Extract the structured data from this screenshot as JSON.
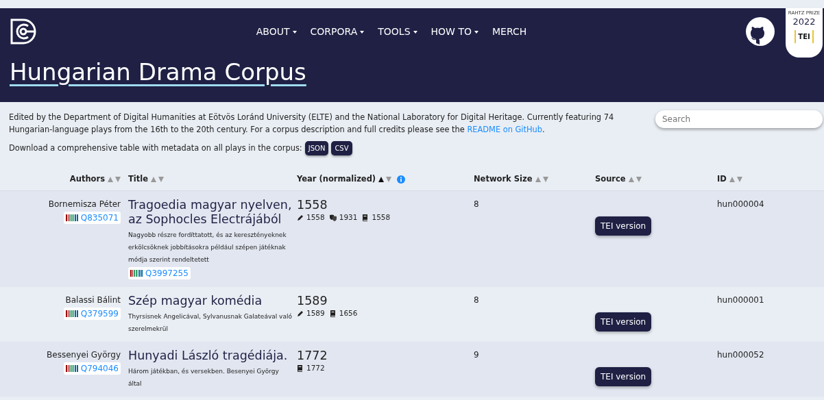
{
  "navbar": {
    "menu": [
      {
        "label": "ABOUT",
        "dropdown": true
      },
      {
        "label": "CORPORA",
        "dropdown": true
      },
      {
        "label": "TOOLS",
        "dropdown": true
      },
      {
        "label": "HOW TO",
        "dropdown": true
      },
      {
        "label": "MERCH",
        "dropdown": false
      }
    ],
    "badge": {
      "prize": "RAHTZ PRIZE",
      "year": "2022",
      "mark": "TEI"
    }
  },
  "title": "Hungarian Drama Corpus",
  "intro": {
    "text": "Edited by the Department of Digital Humanities at Eötvös Loránd University (ELTE) and the National Laboratory for Digital Heritage. Currently featuring 74 Hungarian-language plays from the 16th to the 20th century. For a corpus description and full credits please see the ",
    "link": "README on GitHub",
    "end": "."
  },
  "download": {
    "text": "Download a comprehensive table with metadata on all plays in the corpus:",
    "buttons": [
      "JSON",
      "CSV"
    ]
  },
  "search": {
    "placeholder": "Search"
  },
  "table": {
    "columns": [
      {
        "label": "Authors",
        "sorted_ascending": false
      },
      {
        "label": "Title",
        "sorted_ascending": false
      },
      {
        "label": "Year (normalized)",
        "sorted_ascending": true,
        "info": true
      },
      {
        "label": "Network Size",
        "sorted_ascending": false
      },
      {
        "label": "Source",
        "sorted_ascending": false
      },
      {
        "label": "ID",
        "sorted_ascending": false
      }
    ],
    "rows": [
      {
        "author": "Bornemisza Péter",
        "author_qid": "Q835071",
        "title": "Tragoedia magyar nyelven, az Sophocles Electrájából",
        "subtitle": "Nagyobb részre fordíttatott, és az keresztényeknek erkölcsöknek jobbításokra például szépen játéknak módja szerint rendeltetett",
        "title_qid": "Q3997255",
        "year": "1558",
        "dates": [
          {
            "kind": "written",
            "year": "1558"
          },
          {
            "kind": "premiere",
            "year": "1931"
          },
          {
            "kind": "print",
            "year": "1558"
          }
        ],
        "network_size": "8",
        "source": "TEI version",
        "id": "hun000004"
      },
      {
        "author": "Balassi Bálint",
        "author_qid": "Q379599",
        "title": "Szép magyar komédia",
        "subtitle": "Thyrsisnek Angelicával, Sylvanusnak Galateával való szerelmekrül",
        "year": "1589",
        "dates": [
          {
            "kind": "written",
            "year": "1589"
          },
          {
            "kind": "print",
            "year": "1656"
          }
        ],
        "network_size": "8",
        "source": "TEI version",
        "id": "hun000001"
      },
      {
        "author": "Bessenyei György",
        "author_qid": "Q794046",
        "title": "Hunyadi László tragédiája.",
        "subtitle": "Három játékban, és versekben. Besenyei György által",
        "year": "1772",
        "dates": [
          {
            "kind": "print",
            "year": "1772"
          }
        ],
        "network_size": "9",
        "source": "TEI version",
        "id": "hun000052"
      }
    ]
  }
}
